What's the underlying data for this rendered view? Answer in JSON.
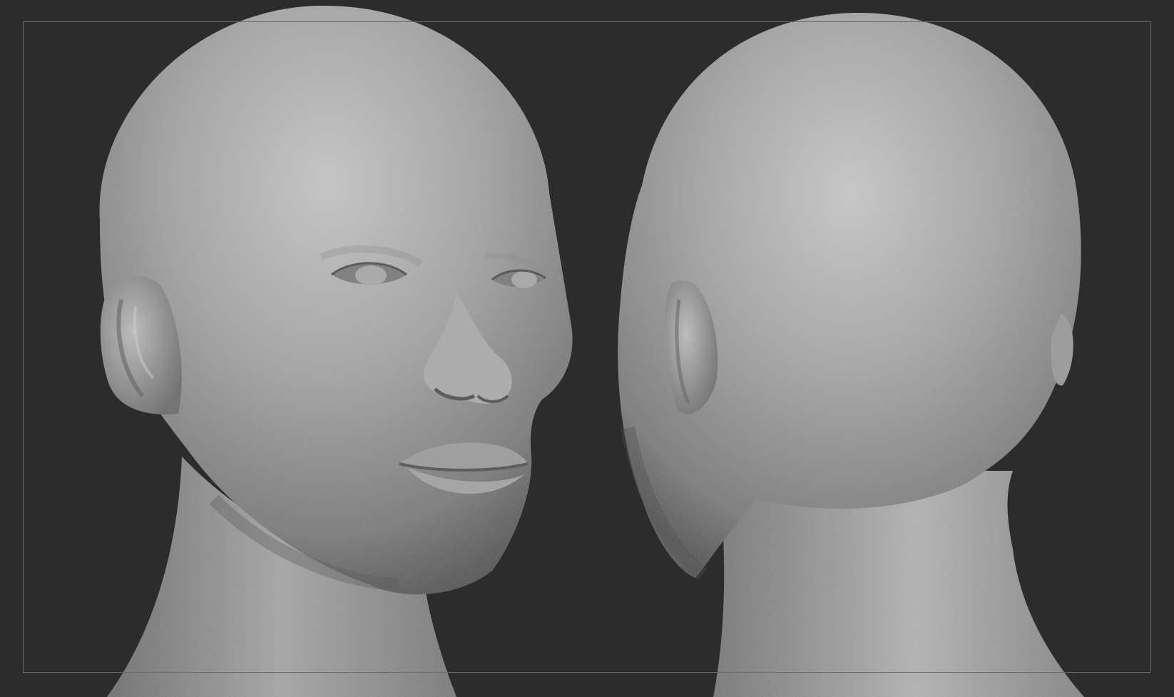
{
  "scene": {
    "background_color": "#2c2c2c",
    "frame_color": "#6a6a6a",
    "clay_light": "#b9b9b9",
    "clay_mid": "#8e8e8e",
    "clay_dark": "#4a4a4a",
    "views": [
      {
        "name": "front-three-quarter-view"
      },
      {
        "name": "back-three-quarter-view"
      }
    ]
  }
}
